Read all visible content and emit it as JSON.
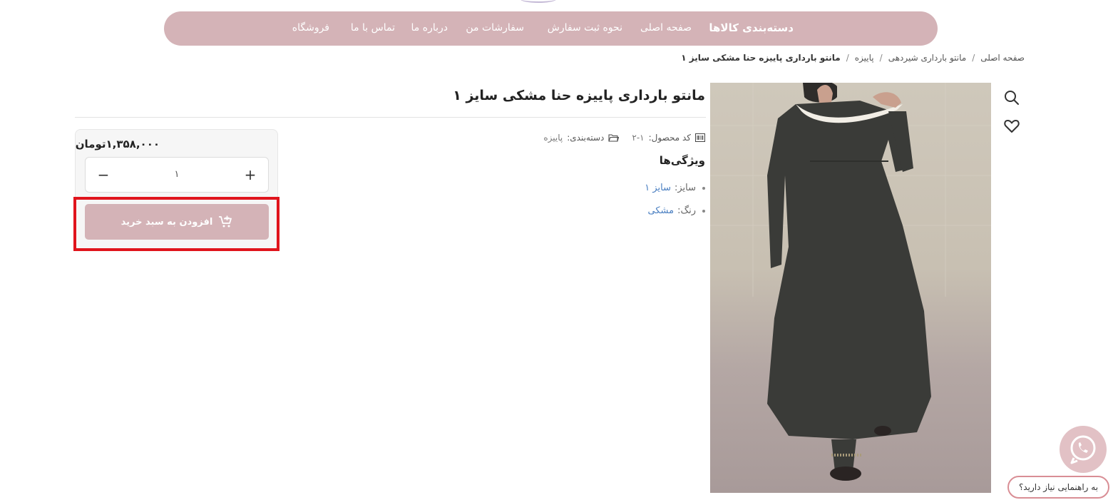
{
  "nav": {
    "categories": "دسته‌بندی کالاها",
    "home": "صفحه اصلی",
    "how_to_order": "نحوه ثبت سفارش",
    "my_orders": "سفارشات من",
    "about": "درباره ما",
    "contact": "تماس با ما",
    "shop": "فروشگاه"
  },
  "breadcrumb": {
    "home": "صفحه اصلی",
    "category": "مانتو بارداری شیردهی",
    "season": "پاییزه",
    "current": "مانتو بارداری پاییزه حنا مشکی سایز ۱"
  },
  "product": {
    "title": "مانتو بارداری پاییزه حنا مشکی سایز ۱",
    "code_label": "کد محصول:",
    "code_value": "۲-۱",
    "category_label": "دسته‌بندی:",
    "category_value": "پاییزه",
    "features_heading": "ویژگی‌ها",
    "size_label": "سایز:",
    "size_value": "سایز ۱",
    "color_label": "رنگ:",
    "color_value": "مشکی"
  },
  "buy": {
    "price": "۱,۳۵۸,۰۰۰تومان",
    "quantity": "۱",
    "minus": "−",
    "plus": "+",
    "add_to_cart": "افزودن به سبد خرید"
  },
  "support": {
    "help_text": "به راهنمایی نیاز دارید؟"
  },
  "colors": {
    "accent": "#d4b3b7",
    "link": "#4a7fc1",
    "highlight": "#e0141c"
  }
}
